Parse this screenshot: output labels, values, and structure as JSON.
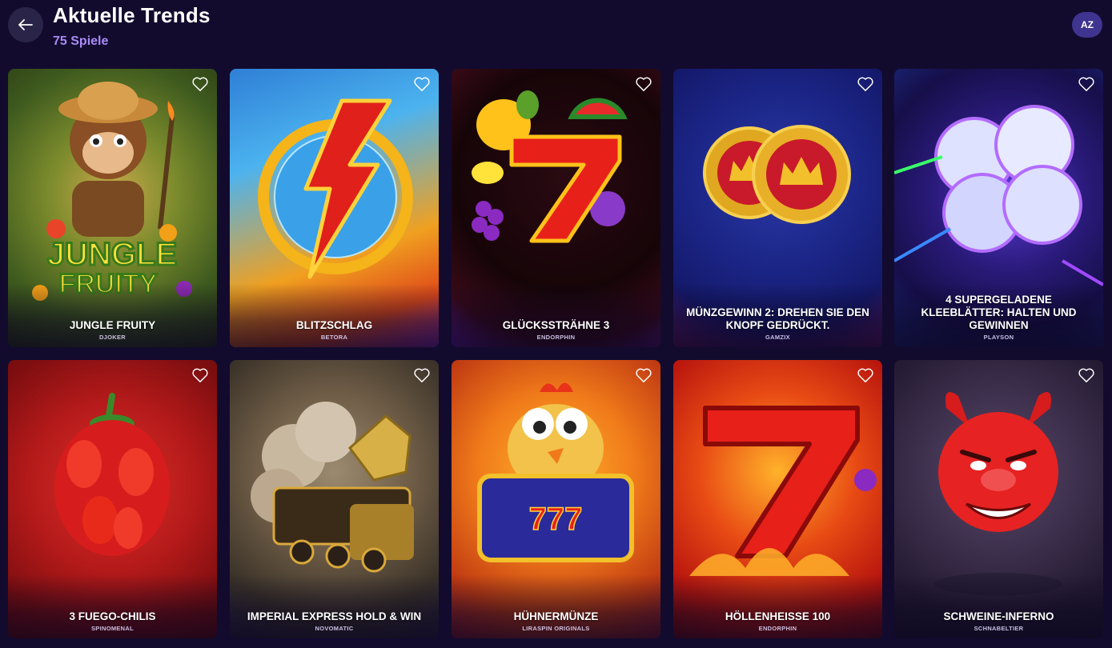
{
  "header": {
    "title": "Aktuelle Trends",
    "count_label": "75 Spiele",
    "sort_label": "AZ",
    "back_icon": "arrow-left-icon"
  },
  "games": [
    {
      "name": "JUNGLE FRUITY",
      "provider": "DJOKER",
      "art": "monkey-jungle-fruits"
    },
    {
      "name": "BLITZSCHLAG",
      "provider": "BETORA",
      "art": "lightning-bolt-ring"
    },
    {
      "name": "GLÜCKSSTRÄHNE 3",
      "provider": "ENDORPHIN",
      "art": "lucky-seven-fruits"
    },
    {
      "name": "MÜNZGEWINN 2: DREHEN SIE DEN KNOPF GEDRÜCKT.",
      "provider": "GAMZIX",
      "art": "gold-crown-coins"
    },
    {
      "name": "4 SUPERGELADENE KLEEBLÄTTER: HALTEN UND GEWINNEN",
      "provider": "PLAYSON",
      "art": "crystal-clover"
    },
    {
      "name": "3 FUEGO-CHILIS",
      "provider": "SPINOMENAL",
      "art": "chili-peppers"
    },
    {
      "name": "IMPERIAL EXPRESS HOLD & WIN",
      "provider": "NOVOMATIC",
      "art": "dragon-train"
    },
    {
      "name": "HÜHNERMÜNZE",
      "provider": "LIRASPIN ORIGINALS",
      "art": "chicken-slot-reels"
    },
    {
      "name": "HÖLLENHEISSE 100",
      "provider": "ENDORPHIN",
      "art": "flaming-seven"
    },
    {
      "name": "SCHWEINE-INFERNO",
      "provider": "SCHNABELTIER",
      "art": "devil-pig"
    }
  ],
  "favorite_icon": "heart-outline-icon"
}
